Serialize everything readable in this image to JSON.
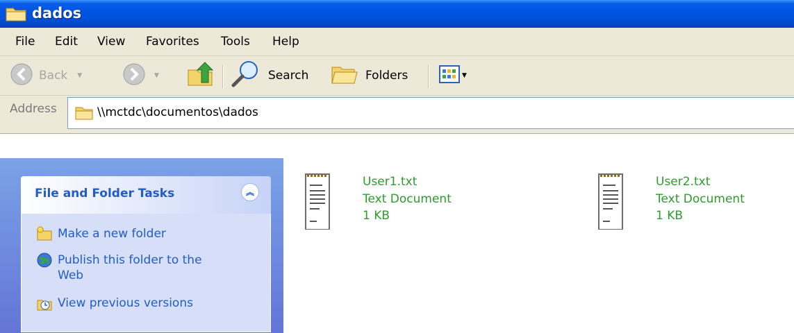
{
  "window": {
    "title": "dados"
  },
  "menubar": {
    "items": [
      "File",
      "Edit",
      "View",
      "Favorites",
      "Tools",
      "Help"
    ]
  },
  "toolbar": {
    "back_label": "Back",
    "search_label": "Search",
    "folders_label": "Folders"
  },
  "address": {
    "label": "Address",
    "value": "\\\\mctdc\\documentos\\dados"
  },
  "tasks_panel": {
    "title": "File and Folder Tasks",
    "items": [
      {
        "label": "Make a new folder",
        "icon": "new-folder-icon"
      },
      {
        "label": "Publish this folder to the Web",
        "icon": "publish-web-icon"
      },
      {
        "label": "View previous versions",
        "icon": "previous-versions-icon"
      }
    ]
  },
  "files": [
    {
      "name": "User1.txt",
      "type": "Text Document",
      "size": "1 KB",
      "icon": "text-document-icon"
    },
    {
      "name": "User2.txt",
      "type": "Text Document",
      "size": "1 KB",
      "icon": "text-document-icon"
    }
  ],
  "colors": {
    "titlebar": "#0054e3",
    "chrome": "#ece9d8",
    "task_link": "#215dc6",
    "file_text": "#2e9a2e"
  }
}
